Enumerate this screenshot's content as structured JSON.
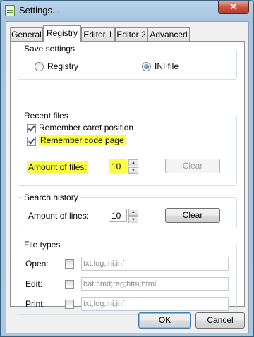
{
  "window": {
    "title": "Settings...",
    "close_glyph": "✕"
  },
  "tabs": [
    {
      "label": "General",
      "active": false
    },
    {
      "label": "Registry",
      "active": true
    },
    {
      "label": "Editor 1",
      "active": false
    },
    {
      "label": "Editor 2",
      "active": false
    },
    {
      "label": "Advanced",
      "active": false
    }
  ],
  "save_settings": {
    "title": "Save settings",
    "registry_label": "Registry",
    "registry_selected": false,
    "ini_label": "INI file",
    "ini_selected": true
  },
  "recent_files": {
    "title": "Recent files",
    "remember_caret_label": "Remember caret position",
    "remember_caret_checked": true,
    "remember_code_page_label": "Remember code page",
    "remember_code_page_checked": true,
    "amount_label": "Amount of files:",
    "amount_value": "10",
    "clear_label": "Clear",
    "highlight_color": "#fbff3e"
  },
  "search_history": {
    "title": "Search history",
    "amount_label": "Amount of lines:",
    "amount_value": "10",
    "clear_label": "Clear"
  },
  "file_types": {
    "title": "File types",
    "rows": [
      {
        "label": "Open:",
        "checked": false,
        "value": "txt;log;ini;inf"
      },
      {
        "label": "Edit:",
        "checked": false,
        "value": "bat;cmd;reg;htm;html"
      },
      {
        "label": "Print:",
        "checked": false,
        "value": "txt;log;ini;inf"
      }
    ]
  },
  "footer": {
    "ok_label": "OK",
    "cancel_label": "Cancel"
  }
}
